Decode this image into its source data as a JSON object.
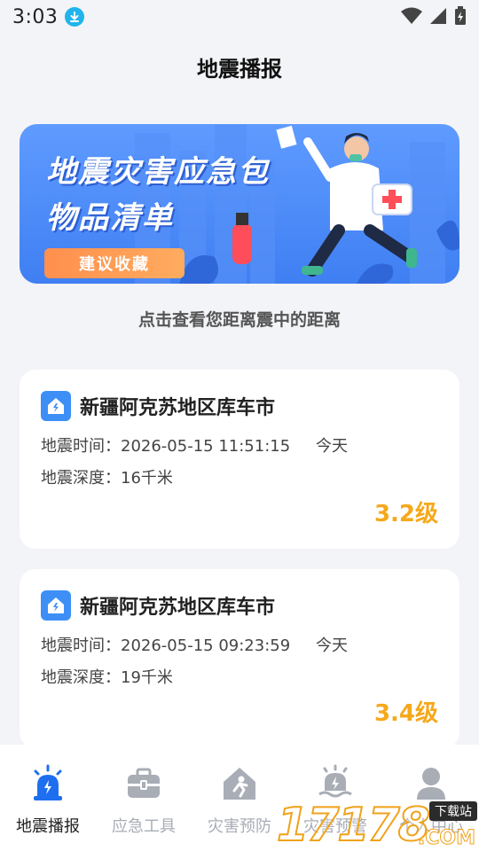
{
  "status_bar": {
    "time": "3:03",
    "icons": [
      "download-icon",
      "wifi-icon",
      "signal-icon",
      "battery-charging-icon"
    ]
  },
  "header": {
    "title": "地震播报"
  },
  "banner": {
    "line1": "地震灾害应急包",
    "line2": "物品清单",
    "button_label": "建议收藏"
  },
  "hint": "点击查看您距离震中的距离",
  "quakes": [
    {
      "location": "新疆阿克苏地区库车市",
      "time_label": "地震时间：",
      "time": "2026-05-15 11:51:15",
      "day": "今天",
      "depth_label": "地震深度：",
      "depth": "16千米",
      "magnitude": "3.2级"
    },
    {
      "location": "新疆阿克苏地区库车市",
      "time_label": "地震时间：",
      "time": "2026-05-15 09:23:59",
      "day": "今天",
      "depth_label": "地震深度：",
      "depth": "19千米",
      "magnitude": "3.4级"
    }
  ],
  "nav": {
    "items": [
      {
        "label": "地震播报",
        "icon": "alarm-light-icon",
        "active": true
      },
      {
        "label": "应急工具",
        "icon": "toolbox-icon",
        "active": false
      },
      {
        "label": "灾害预防",
        "icon": "house-person-icon",
        "active": false
      },
      {
        "label": "灾害预警",
        "icon": "warning-icon",
        "active": false
      },
      {
        "label": "个人中心",
        "icon": "user-icon",
        "active": false
      }
    ]
  },
  "watermark": {
    "text": "17178",
    "suffix": ".COM",
    "tag": "下载站"
  },
  "colors": {
    "accent": "#3d8ff5",
    "magnitude": "#f6a81b",
    "background": "#f3f4f7"
  }
}
